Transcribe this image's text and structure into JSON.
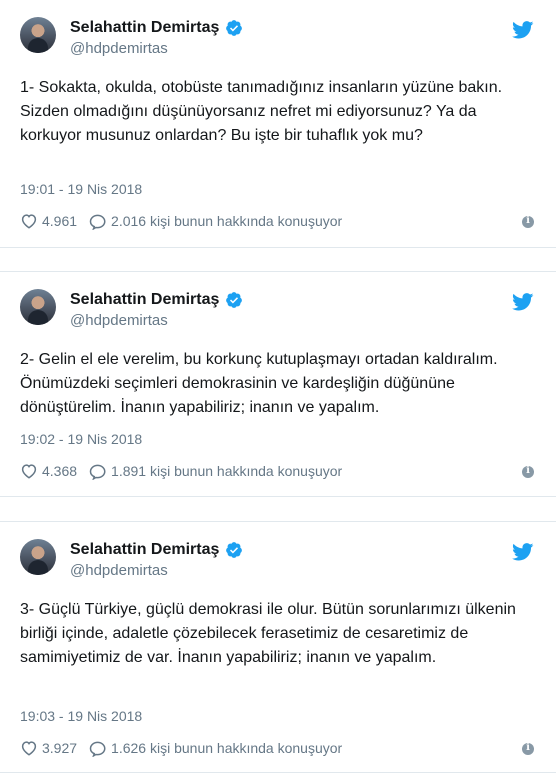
{
  "colors": {
    "twitter_blue": "#1da1f2",
    "text": "#14171a",
    "muted": "#657786",
    "border": "#e1e8ed"
  },
  "tweets": [
    {
      "author": "Selahattin Demirtaş",
      "handle": "@hdpdemirtas",
      "text": "1- Sokakta, okulda, otobüste tanımadığınız insanların yüzüne bakın. Sizden olmadığını düşünüyorsanız nefret mi ediyorsunuz? Ya da korkuyor musunuz onlardan? Bu işte bir tuhaflık yok mu?",
      "timestamp": "19:01 - 19 Nis 2018",
      "likes": "4.961",
      "conversation": "2.016 kişi bunun hakkında konuşuyor"
    },
    {
      "author": "Selahattin Demirtaş",
      "handle": "@hdpdemirtas",
      "text": "2- Gelin el ele verelim, bu korkunç kutuplaşmayı ortadan kaldıralım. Önümüzdeki seçimleri demokrasinin ve kardeşliğin düğününe dönüştürelim. İnanın yapabiliriz; inanın ve yapalım.",
      "timestamp": "19:02 - 19 Nis 2018",
      "likes": "4.368",
      "conversation": "1.891 kişi bunun hakkında konuşuyor"
    },
    {
      "author": "Selahattin Demirtaş",
      "handle": "@hdpdemirtas",
      "text": "3- Güçlü Türkiye, güçlü demokrasi ile olur. Bütün sorunlarımızı ülkenin birliği içinde, adaletle çözebilecek ferasetimiz de cesaretimiz de samimiyetimiz de var. İnanın yapabiliriz; inanın ve yapalım.",
      "timestamp": "19:03 - 19 Nis 2018",
      "likes": "3.927",
      "conversation": "1.626 kişi bunun hakkında konuşuyor"
    }
  ],
  "icons": {
    "verified": "verified-badge-icon",
    "bird": "twitter-bird-icon",
    "like": "heart-icon",
    "reply": "speech-bubble-icon",
    "info": "info-icon"
  }
}
